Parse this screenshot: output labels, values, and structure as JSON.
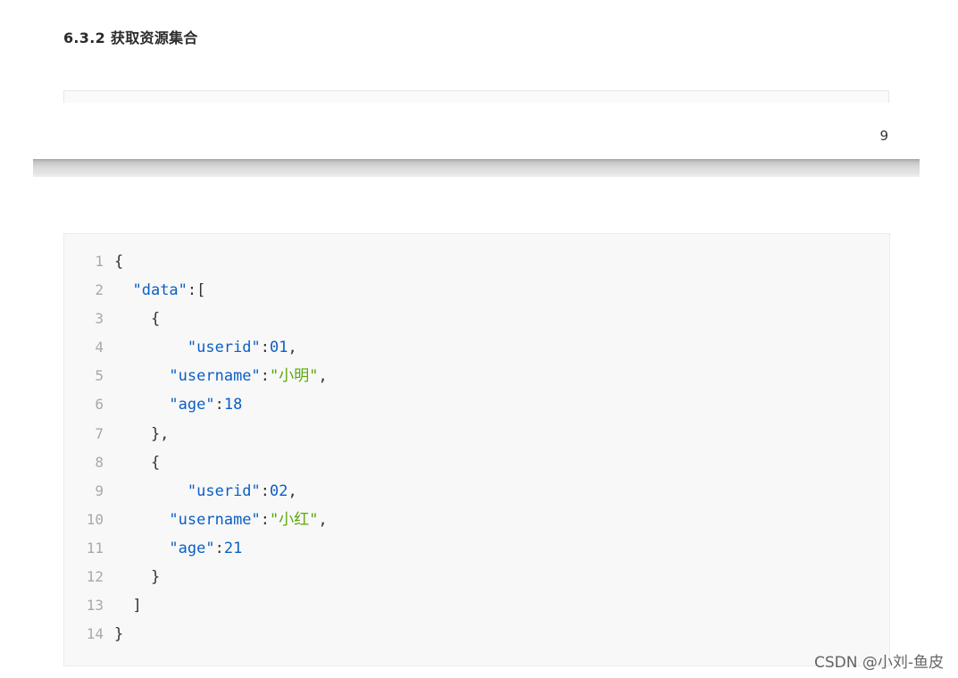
{
  "heading": "6.3.2 获取资源集合",
  "page_number": "9",
  "code": {
    "lines": [
      {
        "num": "1",
        "tokens": [
          {
            "t": "p",
            "v": "{"
          }
        ]
      },
      {
        "num": "2",
        "tokens": [
          {
            "t": "p",
            "v": "  "
          },
          {
            "t": "k",
            "v": "\"data\""
          },
          {
            "t": "p",
            "v": ":["
          }
        ]
      },
      {
        "num": "3",
        "tokens": [
          {
            "t": "p",
            "v": "    {"
          }
        ]
      },
      {
        "num": "4",
        "tokens": [
          {
            "t": "p",
            "v": "        "
          },
          {
            "t": "k",
            "v": "\"userid\""
          },
          {
            "t": "p",
            "v": ":"
          },
          {
            "t": "n",
            "v": "01"
          },
          {
            "t": "p",
            "v": ","
          }
        ]
      },
      {
        "num": "5",
        "tokens": [
          {
            "t": "p",
            "v": "      "
          },
          {
            "t": "k",
            "v": "\"username\""
          },
          {
            "t": "p",
            "v": ":"
          },
          {
            "t": "s",
            "v": "\"小明\""
          },
          {
            "t": "p",
            "v": ","
          }
        ]
      },
      {
        "num": "6",
        "tokens": [
          {
            "t": "p",
            "v": "      "
          },
          {
            "t": "k",
            "v": "\"age\""
          },
          {
            "t": "p",
            "v": ":"
          },
          {
            "t": "n",
            "v": "18"
          }
        ]
      },
      {
        "num": "7",
        "tokens": [
          {
            "t": "p",
            "v": "    },"
          }
        ]
      },
      {
        "num": "8",
        "tokens": [
          {
            "t": "p",
            "v": "    {"
          }
        ]
      },
      {
        "num": "9",
        "tokens": [
          {
            "t": "p",
            "v": "        "
          },
          {
            "t": "k",
            "v": "\"userid\""
          },
          {
            "t": "p",
            "v": ":"
          },
          {
            "t": "n",
            "v": "02"
          },
          {
            "t": "p",
            "v": ","
          }
        ]
      },
      {
        "num": "10",
        "tokens": [
          {
            "t": "p",
            "v": "      "
          },
          {
            "t": "k",
            "v": "\"username\""
          },
          {
            "t": "p",
            "v": ":"
          },
          {
            "t": "s",
            "v": "\"小红\""
          },
          {
            "t": "p",
            "v": ","
          }
        ]
      },
      {
        "num": "11",
        "tokens": [
          {
            "t": "p",
            "v": "      "
          },
          {
            "t": "k",
            "v": "\"age\""
          },
          {
            "t": "p",
            "v": ":"
          },
          {
            "t": "n",
            "v": "21"
          }
        ]
      },
      {
        "num": "12",
        "tokens": [
          {
            "t": "p",
            "v": "    }"
          }
        ]
      },
      {
        "num": "13",
        "tokens": [
          {
            "t": "p",
            "v": "  ]"
          }
        ]
      },
      {
        "num": "14",
        "tokens": [
          {
            "t": "p",
            "v": "}"
          }
        ]
      }
    ]
  },
  "watermark": "CSDN @小刘-鱼皮",
  "colors": {
    "key": "#0b5fc4",
    "number": "#0b5fc4",
    "string": "#5aa80a",
    "punctuation": "#333333",
    "line_number": "#a9a9a9"
  }
}
